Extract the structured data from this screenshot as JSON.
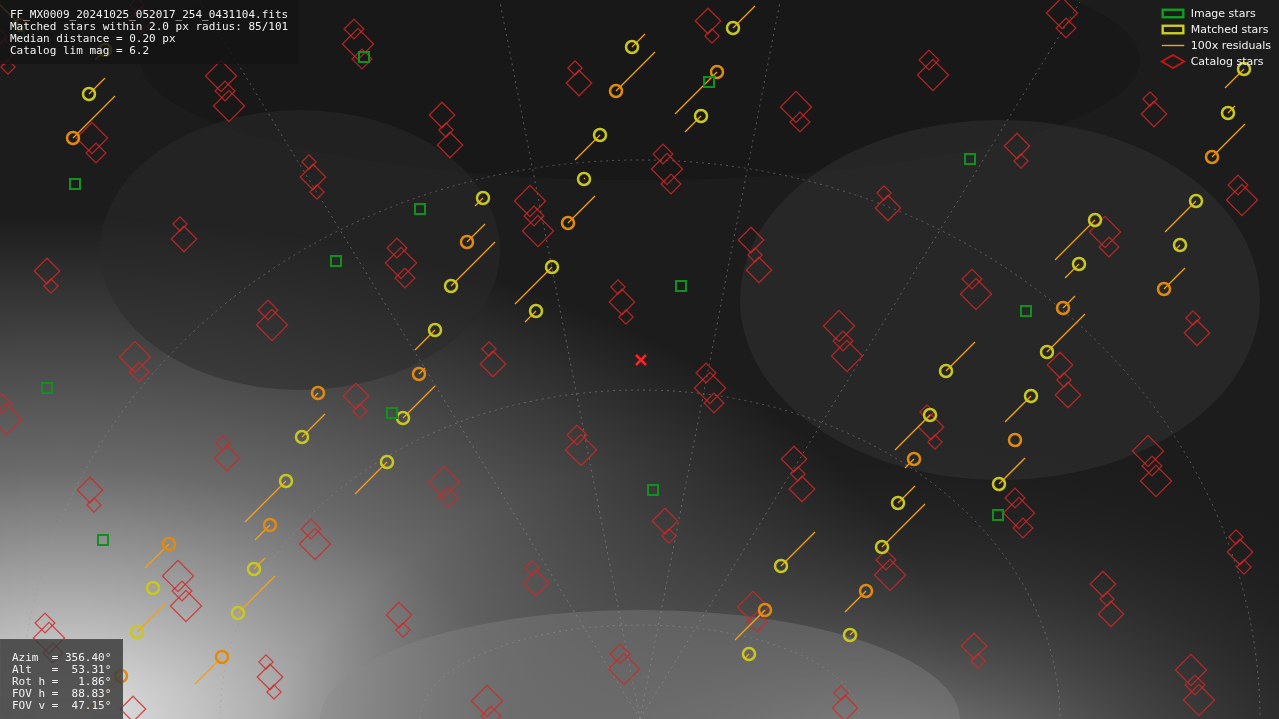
{
  "info": {
    "lines": [
      "FF_MX0009_20241025_052017_254_0431104.fits",
      "Matched stars within 2.0 px radius: 85/101",
      "Median distance = 0.20 px",
      "Catalog lim mag = 6.2"
    ]
  },
  "legend": [
    {
      "label": "Image stars"
    },
    {
      "kind": "matched",
      "label": "Matched stars"
    },
    {
      "kind": "residual",
      "label": "100x residuals"
    },
    {
      "kind": "catalog",
      "label": "Catalog stars"
    }
  ],
  "pointing": {
    "lines": [
      "Azim  = 356.40°",
      "Alt   =  53.31°",
      "Rot h =   1.86°",
      "FOV h =  88.83°",
      "FOV v =  47.15°"
    ]
  }
}
